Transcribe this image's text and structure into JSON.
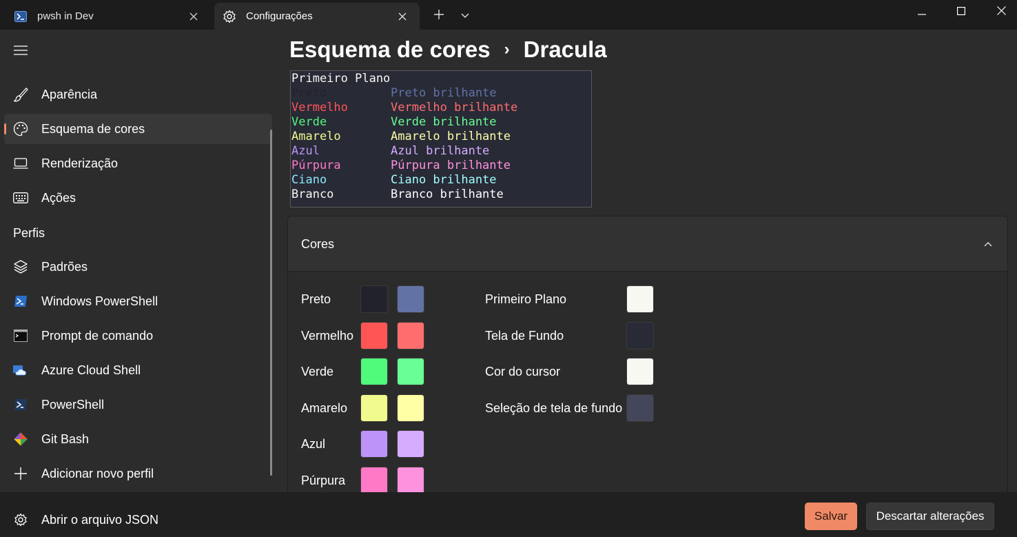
{
  "tabs": [
    {
      "label": "pwsh in Dev",
      "icon": "powershell-icon"
    },
    {
      "label": "Configurações",
      "icon": "gear-icon"
    }
  ],
  "sidebar": {
    "items": [
      {
        "label": "Aparência",
        "icon": "paintbrush-icon"
      },
      {
        "label": "Esquema de cores",
        "icon": "palette-icon",
        "selected": true
      },
      {
        "label": "Renderização",
        "icon": "monitor-icon"
      },
      {
        "label": "Ações",
        "icon": "keyboard-icon"
      }
    ],
    "section_label": "Perfis",
    "profiles": [
      {
        "label": "Padrões",
        "icon": "layers-icon"
      },
      {
        "label": "Windows PowerShell",
        "icon": "powershell-icon"
      },
      {
        "label": "Prompt de comando",
        "icon": "cmd-icon"
      },
      {
        "label": "Azure Cloud Shell",
        "icon": "azure-cloud-icon"
      },
      {
        "label": "PowerShell",
        "icon": "powershell-icon"
      },
      {
        "label": "Git Bash",
        "icon": "git-icon"
      },
      {
        "label": "Adicionar novo perfil",
        "icon": "plus-icon"
      }
    ],
    "json_label": "Abrir o arquivo JSON"
  },
  "breadcrumb": {
    "parent": "Esquema de cores",
    "separator": "›",
    "current": "Dracula"
  },
  "preview": {
    "header": "Primeiro Plano",
    "rows": [
      {
        "normal": "Preto",
        "bright": "Preto brilhante",
        "color": "#21222c",
        "bright_color": "#6272a4"
      },
      {
        "normal": "Vermelho",
        "bright": "Vermelho brilhante",
        "color": "#ff5555",
        "bright_color": "#ff6e6e"
      },
      {
        "normal": "Verde",
        "bright": "Verde brilhante",
        "color": "#50fa7b",
        "bright_color": "#69ff94"
      },
      {
        "normal": "Amarelo",
        "bright": "Amarelo brilhante",
        "color": "#f1fa8c",
        "bright_color": "#ffffa5"
      },
      {
        "normal": "Azul",
        "bright": "Azul brilhante",
        "color": "#bd93f9",
        "bright_color": "#d6acff"
      },
      {
        "normal": "Púrpura",
        "bright": "Púrpura brilhante",
        "color": "#ff79c6",
        "bright_color": "#ff92df"
      },
      {
        "normal": "Ciano",
        "bright": "Ciano brilhante",
        "color": "#8be9fd",
        "bright_color": "#a4ffff"
      },
      {
        "normal": "Branco",
        "bright": "Branco brilhante",
        "color": "#f8f8f2",
        "bright_color": "#ffffff"
      }
    ]
  },
  "colors_section": {
    "title": "Cores",
    "palette": [
      {
        "label": "Preto",
        "normal": "#21222c",
        "bright": "#6272a4"
      },
      {
        "label": "Vermelho",
        "normal": "#ff5555",
        "bright": "#ff6e6e"
      },
      {
        "label": "Verde",
        "normal": "#50fa7b",
        "bright": "#69ff94"
      },
      {
        "label": "Amarelo",
        "normal": "#f1fa8c",
        "bright": "#ffffa5"
      },
      {
        "label": "Azul",
        "normal": "#bd93f9",
        "bright": "#d6acff"
      },
      {
        "label": "Púrpura",
        "normal": "#ff79c6",
        "bright": "#ff92df"
      }
    ],
    "system": [
      {
        "label": "Primeiro Plano",
        "color": "#f8f8f2"
      },
      {
        "label": "Tela de Fundo",
        "color": "#282a36"
      },
      {
        "label": "Cor do cursor",
        "color": "#f8f8f2"
      },
      {
        "label": "Seleção de tela de fundo",
        "color": "#44475a"
      }
    ]
  },
  "actions": {
    "save": "Salvar",
    "discard": "Descartar alterações"
  },
  "accent_color": "#f08a66"
}
